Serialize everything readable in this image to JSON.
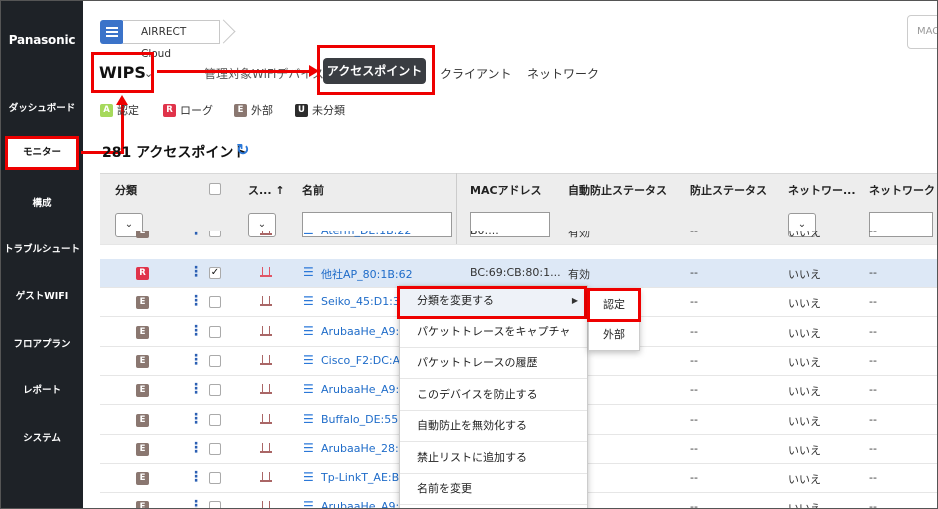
{
  "sidebar": {
    "brand": "Panasonic",
    "items": [
      {
        "label": "ダッシュボード",
        "active": false
      },
      {
        "label": "モニター",
        "active": true
      },
      {
        "label": "構成",
        "active": false
      },
      {
        "label": "トラブルシュート",
        "active": false
      },
      {
        "label": "ゲストWIFI",
        "active": false
      },
      {
        "label": "フロアプラン",
        "active": false
      },
      {
        "label": "レポート",
        "active": false
      },
      {
        "label": "システム",
        "active": false
      }
    ]
  },
  "header": {
    "breadcrumb": "AIRRECT Cloud",
    "search_placeholder": "MAC",
    "section": "WIPS",
    "tabs": [
      {
        "label": "管理対象WiFiデバイス",
        "active": false
      },
      {
        "label": "アクセスポイント",
        "active": true
      },
      {
        "label": "クライアント",
        "active": false
      },
      {
        "label": "ネットワーク",
        "active": false
      }
    ]
  },
  "legend": [
    {
      "code": "A",
      "label": "認定"
    },
    {
      "code": "R",
      "label": "ローグ"
    },
    {
      "code": "E",
      "label": "外部"
    },
    {
      "code": "U",
      "label": "未分類"
    }
  ],
  "list": {
    "title": "281 アクセスポイント",
    "refresh_icon": "↻"
  },
  "table": {
    "columns": [
      "分類",
      "ス... ↑",
      "名前",
      "MACアドレス",
      "自動防止ステータス",
      "防止ステータス",
      "ネットワー...",
      "ネットワーク"
    ],
    "rows": [
      {
        "class": "E",
        "checked": false,
        "name": "Aterm_DE:1B:22",
        "mac": "B0:...",
        "auto": "有効",
        "prevent": "--",
        "network": "いいえ",
        "network2": "--",
        "selected": false
      },
      {
        "class": "R",
        "checked": true,
        "name": "他社AP_80:1B:62",
        "mac": "BC:69:CB:80:1...",
        "auto": "有効",
        "prevent": "--",
        "network": "いいえ",
        "network2": "--",
        "selected": true
      },
      {
        "class": "E",
        "checked": false,
        "name": "Seiko_45:D1:32",
        "mac": "",
        "auto": "",
        "prevent": "--",
        "network": "いいえ",
        "network2": "--",
        "selected": false
      },
      {
        "class": "E",
        "checked": false,
        "name": "ArubaaHe_A9:B4",
        "mac": "",
        "auto": "",
        "prevent": "--",
        "network": "いいえ",
        "network2": "--",
        "selected": false
      },
      {
        "class": "E",
        "checked": false,
        "name": "Cisco_F2:DC:A2",
        "mac": "",
        "auto": "",
        "prevent": "--",
        "network": "いいえ",
        "network2": "--",
        "selected": false
      },
      {
        "class": "E",
        "checked": false,
        "name": "ArubaaHe_A9:B4",
        "mac": "",
        "auto": "",
        "prevent": "--",
        "network": "いいえ",
        "network2": "--",
        "selected": false
      },
      {
        "class": "E",
        "checked": false,
        "name": "Buffalo_DE:55:F",
        "mac": "",
        "auto": "",
        "prevent": "--",
        "network": "いいえ",
        "network2": "--",
        "selected": false
      },
      {
        "class": "E",
        "checked": false,
        "name": "ArubaaHe_28:53",
        "mac": "",
        "auto": "",
        "prevent": "--",
        "network": "いいえ",
        "network2": "--",
        "selected": false
      },
      {
        "class": "E",
        "checked": false,
        "name": "Tp-LinkT_AE:B4:",
        "mac": "",
        "auto": "",
        "prevent": "--",
        "network": "いいえ",
        "network2": "--",
        "selected": false
      },
      {
        "class": "E",
        "checked": false,
        "name": "ArubaaHe_A9:B4",
        "mac": "",
        "auto": "",
        "prevent": "--",
        "network": "いいえ",
        "network2": "--",
        "selected": false
      }
    ]
  },
  "context_menu": {
    "items": [
      "分類を変更する",
      "パケットトレースをキャプチャ",
      "パケットトレースの履歴",
      "このデバイスを防止する",
      "自動防止を無効化する",
      "禁止リストに追加する",
      "名前を変更"
    ],
    "submenu": [
      "認定",
      "外部"
    ]
  },
  "colors": {
    "sidebar": "#1e2227",
    "accent": "#2b78d8",
    "annotation": "#e00000",
    "rogue": "#e0334a",
    "external": "#8a7770",
    "authorized": "#a6d95c"
  }
}
